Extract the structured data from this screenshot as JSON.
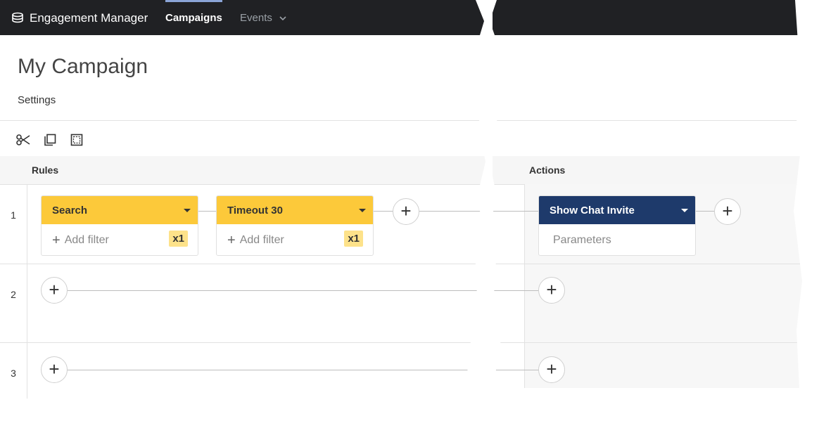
{
  "app": {
    "title": "Engagement Manager"
  },
  "nav": {
    "tabs": [
      {
        "label": "Campaigns",
        "active": true
      },
      {
        "label": "Events",
        "active": false
      }
    ]
  },
  "page": {
    "title": "My Campaign",
    "settings_label": "Settings"
  },
  "toolbar": {
    "icons": [
      "cut-icon",
      "copy-icon",
      "select-all-icon"
    ]
  },
  "columns": {
    "rules": "Rules",
    "actions": "Actions"
  },
  "rows": [
    {
      "number": "1",
      "rules": [
        {
          "title": "Search",
          "filter_placeholder": "Add filter",
          "badge": "x1"
        },
        {
          "title": "Timeout 30",
          "filter_placeholder": "Add filter",
          "badge": "x1"
        }
      ],
      "action": {
        "title": "Show Chat Invite",
        "body": "Parameters"
      }
    },
    {
      "number": "2"
    },
    {
      "number": "3"
    }
  ],
  "colors": {
    "topbar": "#202124",
    "rule_card": "#fcc93a",
    "action_card": "#1e3a6b",
    "badge": "#fde28a"
  }
}
